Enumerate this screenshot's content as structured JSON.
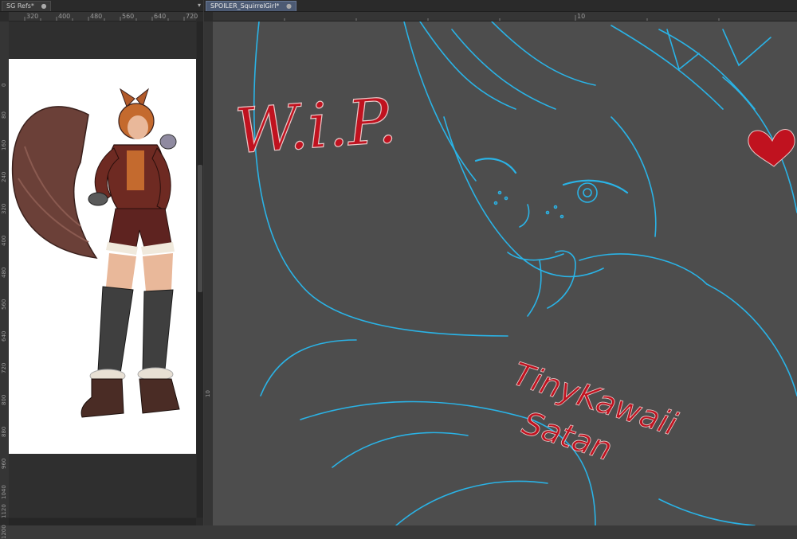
{
  "left_panel": {
    "tab_title": "SG Refs*",
    "tab_close": "●",
    "dropdown": "▾",
    "ruler_h": [
      "320",
      "400",
      "480",
      "560",
      "640",
      "720"
    ],
    "ruler_v": [
      "0",
      "80",
      "160",
      "240",
      "320",
      "400",
      "480",
      "560",
      "640",
      "720",
      "800",
      "880",
      "960",
      "1040",
      "1120",
      "1200"
    ]
  },
  "canvas_panel": {
    "tab_title": "SPOILER_SquirrelGirl*",
    "tab_close": "●",
    "ruler_h": [
      "10"
    ],
    "ruler_v": [
      "10"
    ]
  },
  "artwork": {
    "wip_text": "W.i.P.",
    "signature_line1": "TinyKawaii",
    "signature_line2": "Satan",
    "colors": {
      "sketch_line": "#2ab3e6",
      "lettering": "#c0121f",
      "canvas_bg": "#4d4d4d",
      "reference_bg": "#ffffff"
    }
  }
}
